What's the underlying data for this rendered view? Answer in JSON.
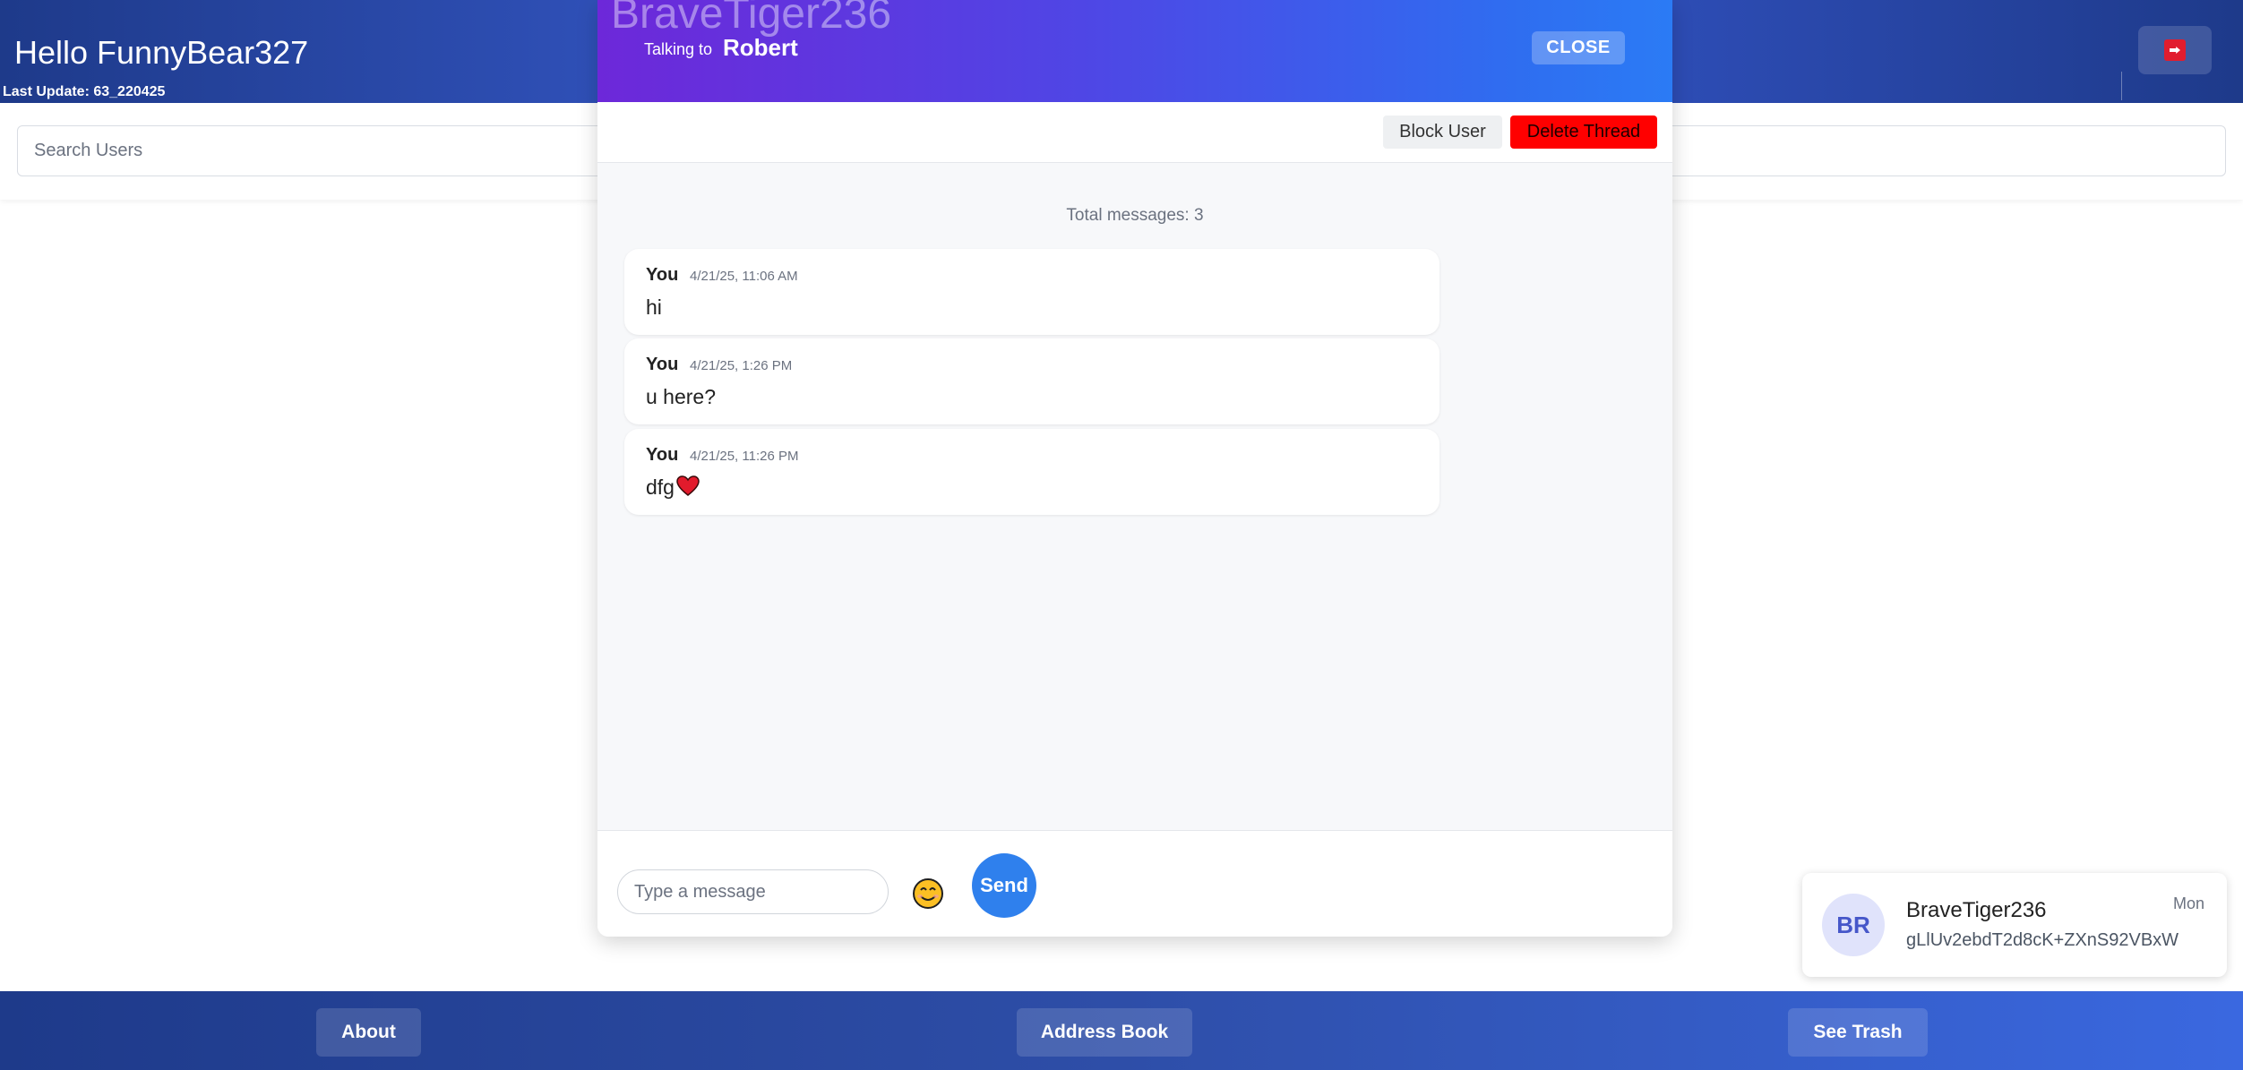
{
  "header": {
    "greeting": "Hello FunnyBear327",
    "last_update": "Last Update: 63_220425",
    "logout_icon": "exit-icon"
  },
  "search": {
    "placeholder": "Search Users",
    "value": ""
  },
  "chat": {
    "ghost_title": "BraveTiger236",
    "talking_to_label": "Talking to",
    "partner_name": "Robert",
    "close_label": "CLOSE",
    "block_label": "Block User",
    "delete_label": "Delete Thread",
    "delete_color": "#ff0000",
    "total_messages": "Total messages: 3",
    "messages": [
      {
        "sender": "You",
        "time": "4/21/25, 11:06 AM",
        "text": "hi"
      },
      {
        "sender": "You",
        "time": "4/21/25, 1:26 PM",
        "text": "u here?"
      },
      {
        "sender": "You",
        "time": "4/21/25, 11:26 PM",
        "text": "dfg",
        "emoji": "heart-icon"
      }
    ],
    "composer": {
      "placeholder": "Type a message",
      "value": "",
      "emoji_icon": "smiley-icon",
      "send_label": "Send",
      "send_color": "#2f80ed"
    }
  },
  "notification": {
    "initials": "BR",
    "name": "BraveTiger236",
    "preview": "gLlUv2ebdT2d8cK+ZXnS92VBxW",
    "time": "Mon"
  },
  "footer": {
    "about_label": "About",
    "address_book_label": "Address Book",
    "trash_label": "See Trash"
  }
}
